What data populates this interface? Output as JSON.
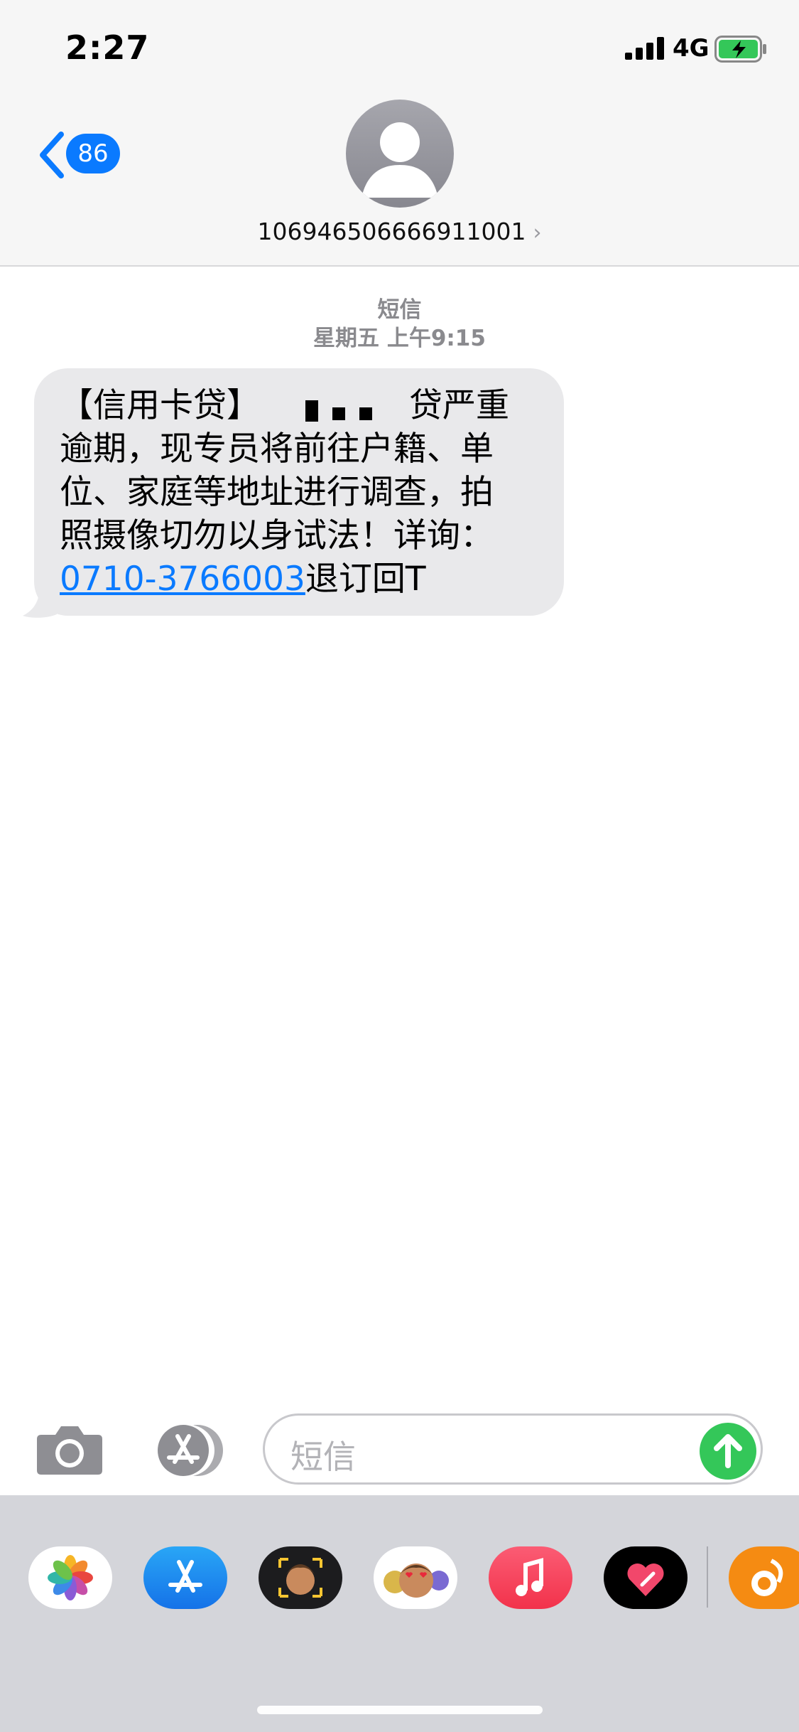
{
  "status": {
    "time": "2:27",
    "network": "4G"
  },
  "nav": {
    "back_count": "86"
  },
  "contact": {
    "number": "106946506666911001",
    "chevron": "›"
  },
  "thread": {
    "label": "短信",
    "time": "星期五 上午9:15"
  },
  "message": {
    "line1_a": "【信用卡贷】",
    "line1_b": "贷严重",
    "line2": "逾期，现专员将前往户籍、单",
    "line3": "位、家庭等地址进行调查，拍",
    "line4": "照摄像切勿以身试法！详询：",
    "link": "0710-3766003",
    "tail": "退订回T"
  },
  "composer": {
    "placeholder": "短信"
  },
  "apps": [
    "photos-app-icon",
    "app-store-app-icon",
    "memoji-app-icon",
    "animoji-app-icon",
    "music-app-icon",
    "digital-touch-app-icon",
    "uc-browser-app-icon"
  ],
  "colors": {
    "accent": "#0a7aff",
    "send": "#34c759",
    "bubble": "#e9e9eb"
  }
}
